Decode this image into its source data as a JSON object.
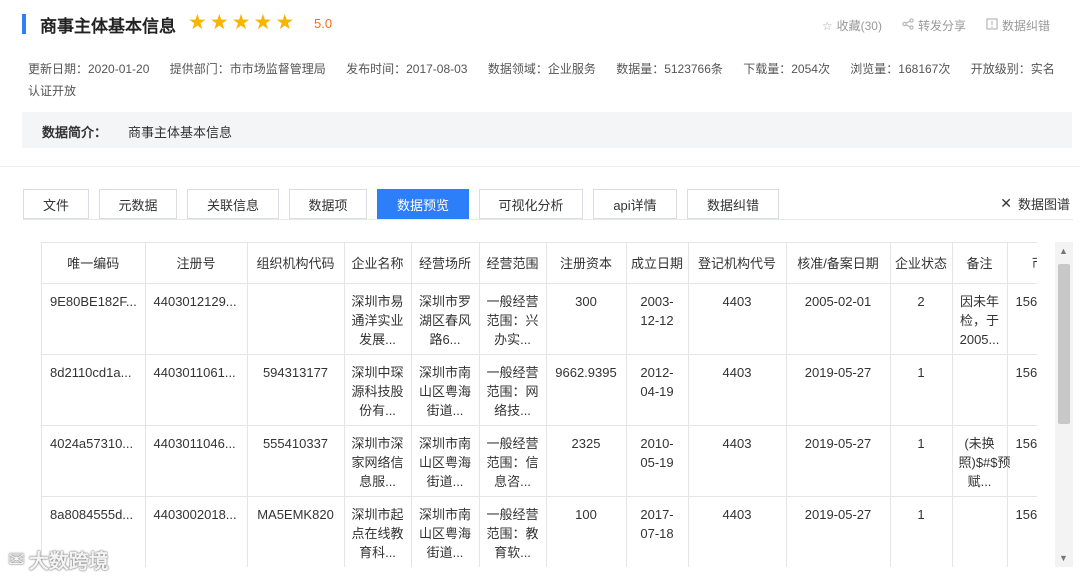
{
  "header": {
    "title": "商事主体基本信息",
    "stars": [
      "★",
      "★",
      "★",
      "★",
      "★"
    ],
    "rating": "5.0",
    "accent_color": "#2d7ff9",
    "star_color": "#f7b500"
  },
  "actions": {
    "favorite": "收藏(30)",
    "share": "转发分享",
    "correction": "数据纠错"
  },
  "meta": {
    "updated": "更新日期：2020-01-20",
    "department": "提供部门：市市场监督管理局",
    "published": "发布时间：2017-08-03",
    "domain": "数据领域：企业服务",
    "records": "数据量：5123766条",
    "downloads": "下载量：2054次",
    "views": "浏览量：168167次",
    "open_level": "开放级别：实名认证开放"
  },
  "summary": {
    "label": "数据简介：",
    "text": "商事主体基本信息"
  },
  "tabs": [
    {
      "label": "文件"
    },
    {
      "label": "元数据"
    },
    {
      "label": "关联信息"
    },
    {
      "label": "数据项"
    },
    {
      "label": "数据预览",
      "active": true
    },
    {
      "label": "可视化分析"
    },
    {
      "label": "api详情"
    },
    {
      "label": "数据纠错"
    }
  ],
  "diagram_link": "数据图谱",
  "table": {
    "headers": [
      "唯一编码",
      "注册号",
      "组织机构代码",
      "企业名称",
      "经营场所",
      "经营范围",
      "注册资本",
      "成立日期",
      "登记机构代号",
      "核准/备案日期",
      "企业状态",
      "备注",
      "币种"
    ],
    "rows": [
      [
        "9E80BE182F...",
        "4403012129...",
        "",
        "深圳市易通洋实业发展...",
        "深圳市罗湖区春风路6...",
        "一般经营范围：兴办实...",
        "300",
        "2003-12-12",
        "4403",
        "2005-02-01",
        "2",
        "因未年检，于2005...",
        "156"
      ],
      [
        "8d2110cd1a...",
        "4403011061...",
        "594313177",
        "深圳中琛源科技股份有...",
        "深圳市南山区粤海街道...",
        "一般经营范围：网络技...",
        "9662.9395",
        "2012-04-19",
        "4403",
        "2019-05-27",
        "1",
        "",
        "156"
      ],
      [
        "4024a57310...",
        "4403011046...",
        "555410337",
        "深圳市深家网络信息服...",
        "深圳市南山区粤海街道...",
        "一般经营范围：信息咨...",
        "2325",
        "2010-05-19",
        "4403",
        "2019-05-27",
        "1",
        "(未换照)$#$预赋...",
        "156"
      ],
      [
        "8a8084555d...",
        "4403002018...",
        "MA5EMK820",
        "深圳市起点在线教育科...",
        "深圳市南山区粤海街道...",
        "一般经营范围：教育软...",
        "100",
        "2017-07-18",
        "4403",
        "2019-05-27",
        "1",
        "",
        "156"
      ]
    ]
  },
  "watermark": "大数跨境"
}
